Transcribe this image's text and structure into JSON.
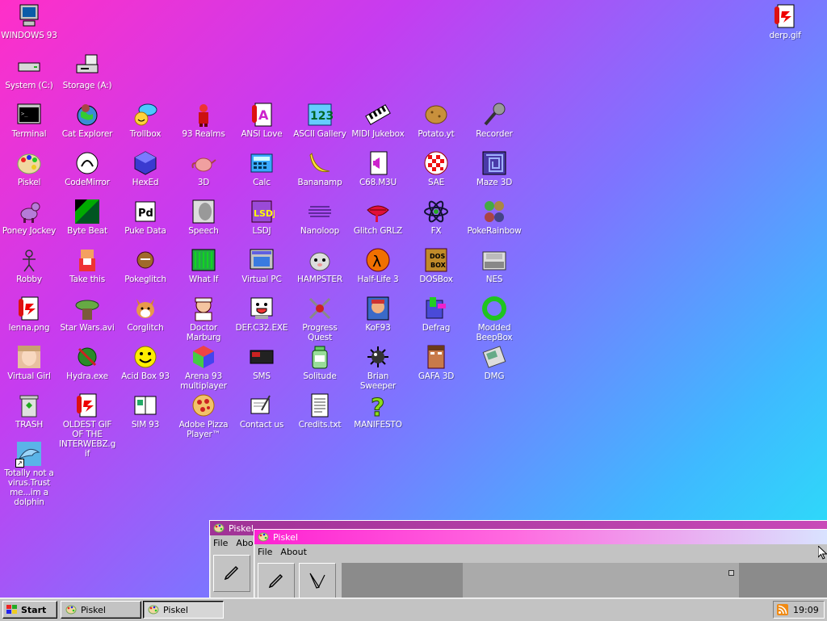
{
  "desktop": {
    "top_icons": {
      "windows93": "WINDOWS 93",
      "system_c": "System (C:)",
      "storage_a": "Storage (A:)",
      "derp_gif": "derp.gif"
    },
    "rows": [
      [
        "Terminal",
        "Cat Explorer",
        "Trollbox",
        "93 Realms",
        "ANSI Love",
        "ASCII Gallery",
        "MIDI Jukebox",
        "Potato.yt",
        "Recorder"
      ],
      [
        "Piskel",
        "CodeMirror",
        "HexEd",
        "3D",
        "Calc",
        "Bananamp",
        "C68.M3U",
        "SAE",
        "Maze 3D"
      ],
      [
        "Poney Jockey",
        "Byte Beat",
        "Puke Data",
        "Speech",
        "LSDJ",
        "Nanoloop",
        "Glitch GRLZ",
        "FX",
        "PokeRainbow"
      ],
      [
        "Robby",
        "Take this",
        "Pokeglitch",
        "What If",
        "Virtual PC",
        "HAMPSTER",
        "Half-Life 3",
        "DOSBox",
        "NES"
      ],
      [
        "lenna.png",
        "Star Wars.avi",
        "Corglitch",
        "Doctor Marburg",
        "DEF.C32.EXE",
        "Progress Quest",
        "KoF93",
        "Defrag",
        "Modded BeepBox"
      ],
      [
        "Virtual Girl",
        "Hydra.exe",
        "Acid Box 93",
        "Arena 93 multiplayer",
        "SMS",
        "Solitude",
        "Brian Sweeper",
        "GAFA 3D",
        "DMG"
      ],
      [
        "TRASH",
        "OLDEST GIF OF THE INTERWEBZ.gif",
        "SIM 93",
        "Adobe Pizza Player™",
        "Contact us",
        "Credits.txt",
        "MANIFESTO"
      ],
      [
        "Totally not a virus.Trust me...im a dolphin"
      ]
    ]
  },
  "windows": {
    "back": {
      "title": "Piskel",
      "menu": [
        "File",
        "Abo"
      ]
    },
    "front": {
      "title": "Piskel",
      "menu": [
        "File",
        "About"
      ]
    }
  },
  "taskbar": {
    "start": "Start",
    "tasks": [
      "Piskel",
      "Piskel"
    ],
    "clock": "19:09"
  },
  "colors": {
    "title_active": "#ff2ad4",
    "title_inactive": "#a03296",
    "face": "#c3c3c3"
  }
}
